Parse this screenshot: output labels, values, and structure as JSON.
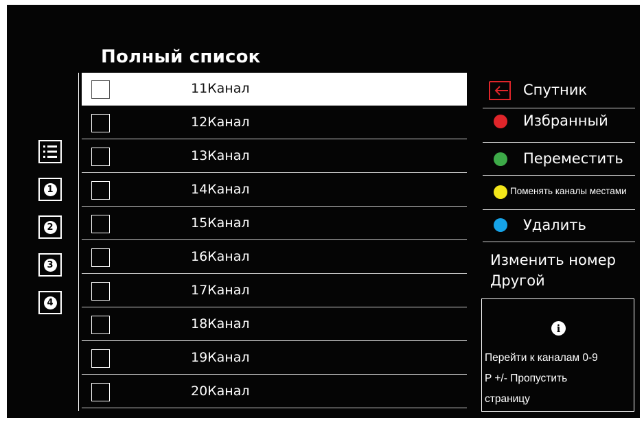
{
  "header": {
    "title": "Полный список"
  },
  "side_icons": [
    {
      "icon": "list-icon",
      "label": ""
    },
    {
      "icon": "number-1-icon",
      "label": "1"
    },
    {
      "icon": "number-2-icon",
      "label": "2"
    },
    {
      "icon": "number-3-icon",
      "label": "3"
    },
    {
      "icon": "number-4-icon",
      "label": "4"
    }
  ],
  "channels": [
    {
      "name": "11Канал",
      "selected": true
    },
    {
      "name": "12Канал",
      "selected": false
    },
    {
      "name": "13Канал",
      "selected": false
    },
    {
      "name": "14Канал",
      "selected": false
    },
    {
      "name": "15Канал",
      "selected": false
    },
    {
      "name": "16Канал",
      "selected": false
    },
    {
      "name": "17Канал",
      "selected": false
    },
    {
      "name": "18Канал",
      "selected": false
    },
    {
      "name": "19Канал",
      "selected": false
    },
    {
      "name": "20Канал",
      "selected": false
    }
  ],
  "menu": {
    "source": {
      "label": "Спутник",
      "icon": "input-source-icon",
      "color": "#e0252a"
    },
    "red": {
      "label": "Избранный",
      "color": "#e0252a"
    },
    "green": {
      "label": "Переместить",
      "color": "#3daa48"
    },
    "yellow": {
      "label": "Поменять каналы местами",
      "color": "#f3e61a"
    },
    "blue": {
      "label": "Удалить",
      "color": "#16a3e8"
    },
    "edit_number": "Изменить номер",
    "other": "Другой"
  },
  "info": {
    "icon": "info-icon",
    "line1": "Перейти к каналам 0-9",
    "line2": "P +/- Пропустить",
    "line3": "страницу"
  },
  "colors": {
    "background": "#050505",
    "text": "#ffffff",
    "selected_row": "#ffffff"
  }
}
